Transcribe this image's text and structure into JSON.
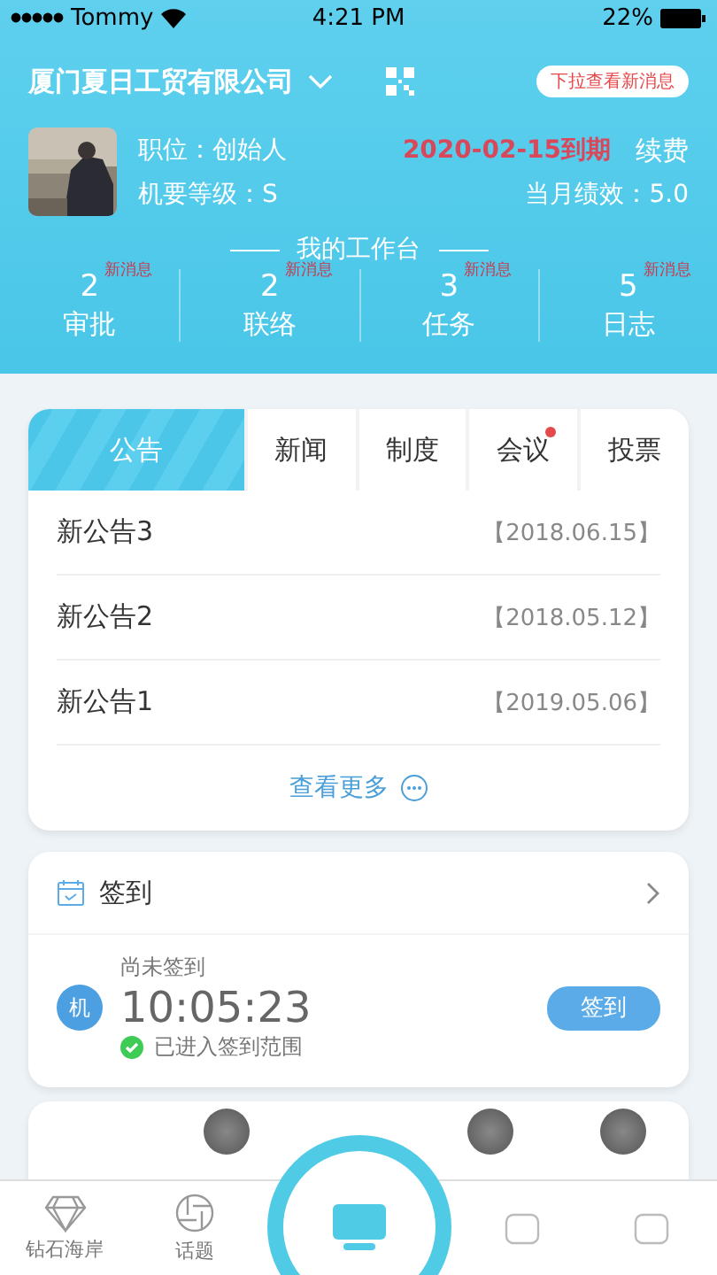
{
  "status_bar": {
    "carrier": "Tommy",
    "time": "4:21 PM",
    "battery": "22%"
  },
  "header": {
    "company": "厦门夏日工贸有限公司",
    "hint": "下拉查看新消息",
    "position": "职位：创始人",
    "level": "机要等级：S",
    "expiry": "2020-02-15到期",
    "renew": "续费",
    "performance": "当月绩效：5.0"
  },
  "workbench": {
    "title": "我的工作台",
    "items": [
      {
        "count": "2",
        "badge": "新消息",
        "label": "审批"
      },
      {
        "count": "2",
        "badge": "新消息",
        "label": "联络"
      },
      {
        "count": "3",
        "badge": "新消息",
        "label": "任务"
      },
      {
        "count": "5",
        "badge": "新消息",
        "label": "日志"
      }
    ]
  },
  "news": {
    "tabs": [
      {
        "label": "公告",
        "selected": true,
        "dot": false
      },
      {
        "label": "新闻",
        "selected": false,
        "dot": false
      },
      {
        "label": "制度",
        "selected": false,
        "dot": false
      },
      {
        "label": "会议",
        "selected": false,
        "dot": true
      },
      {
        "label": "投票",
        "selected": false,
        "dot": false
      }
    ],
    "rows": [
      {
        "title": "新公告3",
        "date": "【2018.06.15】"
      },
      {
        "title": "新公告2",
        "date": "【2018.05.12】"
      },
      {
        "title": "新公告1",
        "date": "【2019.05.06】"
      }
    ],
    "more": "查看更多"
  },
  "checkin": {
    "title": "签到",
    "avatar": "机",
    "status": "尚未签到",
    "time": "10:05:23",
    "range": "已进入签到范围",
    "button": "签到"
  },
  "tab_bar": [
    {
      "label": "钻石海岸",
      "kind": "diamond"
    },
    {
      "label": "话题",
      "kind": "shutter"
    },
    {
      "kind": "center"
    },
    {
      "kind": "plain"
    },
    {
      "kind": "plain"
    }
  ]
}
